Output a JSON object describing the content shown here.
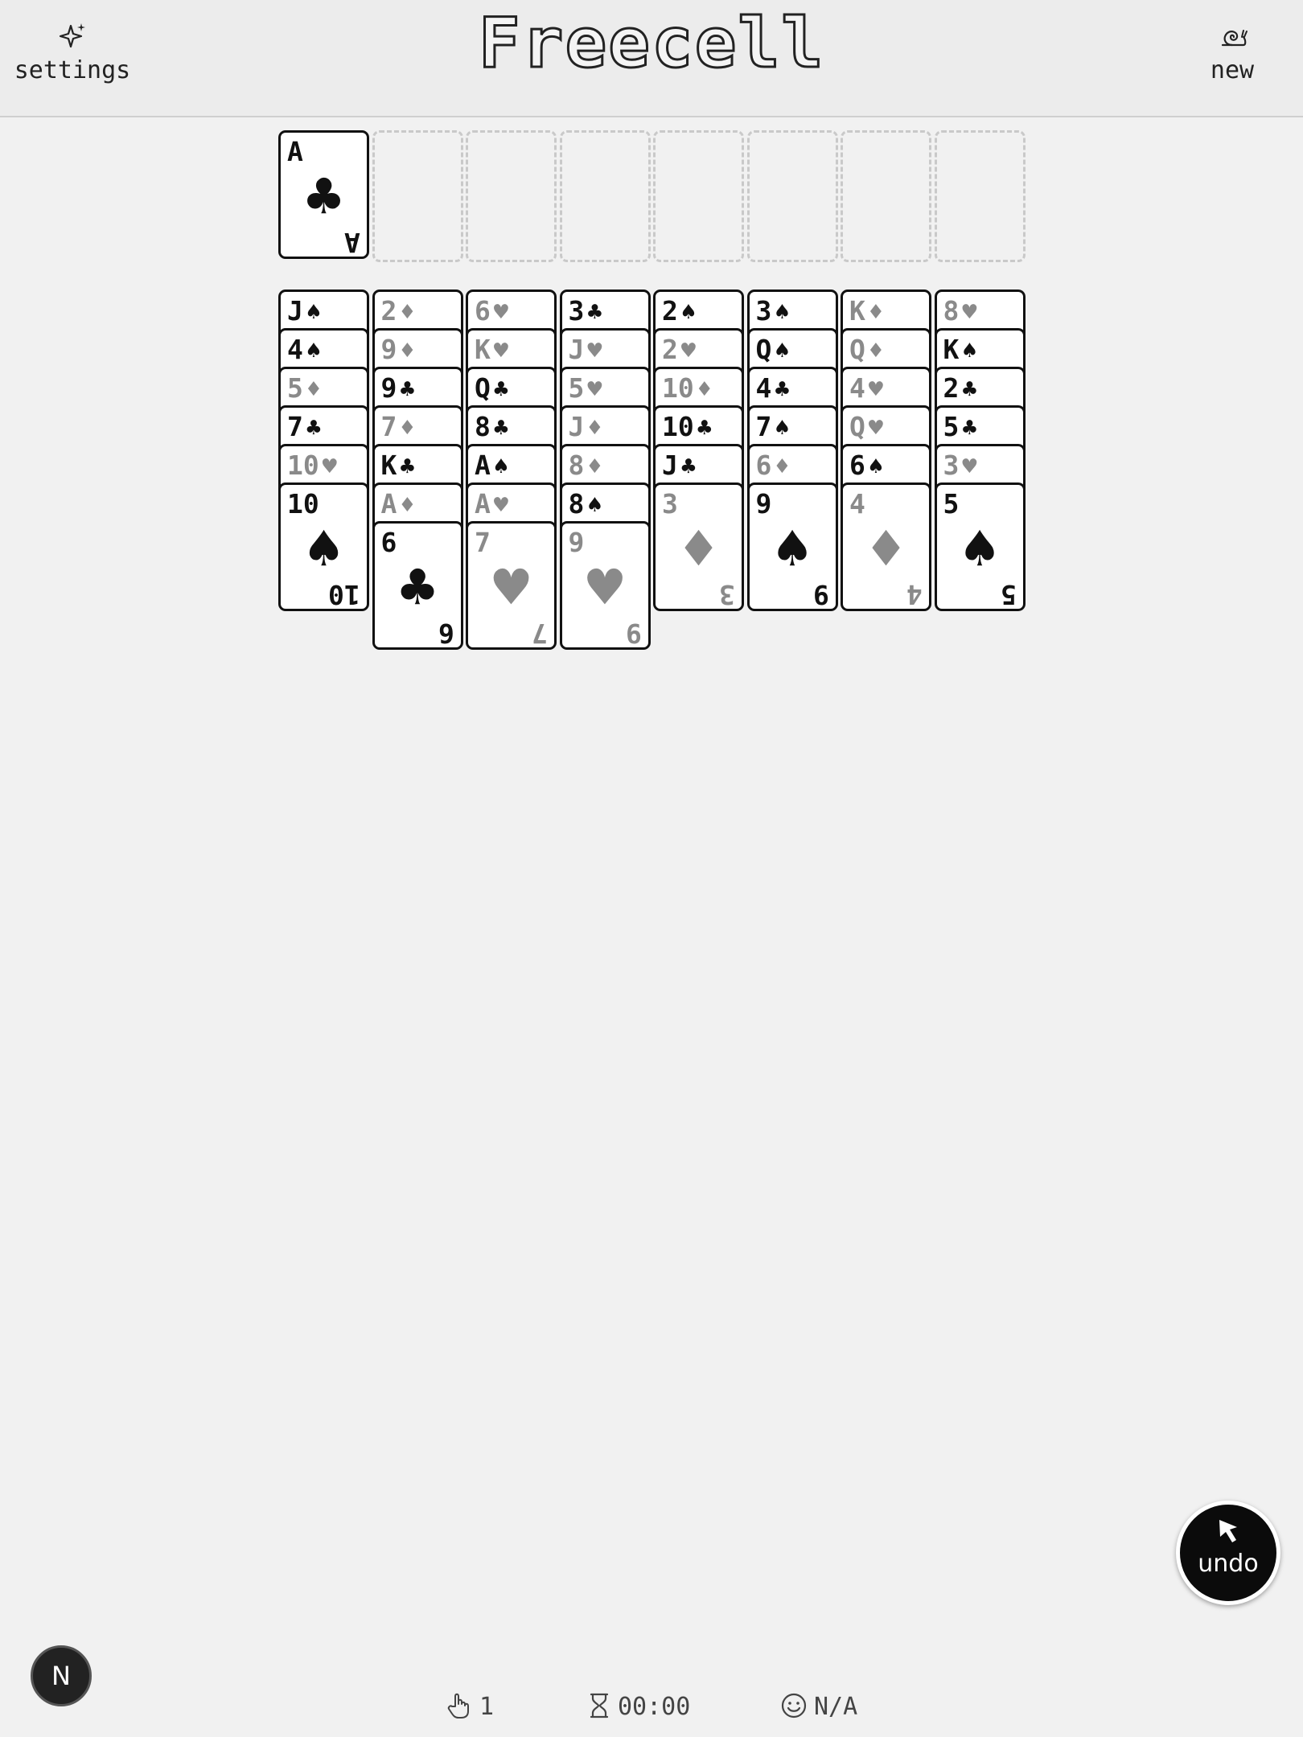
{
  "header": {
    "title": "Freecell",
    "settings_label": "settings",
    "new_label": "new",
    "settings_icon": "sparkle-icon",
    "new_icon": "snail-icon"
  },
  "colors": {
    "red_suit": "#8a8a8a",
    "black_suit": "#111111",
    "background": "#f1f1f1"
  },
  "foundation": {
    "cards": [
      {
        "rank": "A",
        "suit": "♣",
        "color": "black"
      }
    ],
    "empty_slots": 7
  },
  "tableau": {
    "columns": [
      [
        {
          "rank": "J",
          "suit": "♠",
          "color": "black"
        },
        {
          "rank": "4",
          "suit": "♠",
          "color": "black"
        },
        {
          "rank": "5",
          "suit": "♦",
          "color": "red"
        },
        {
          "rank": "7",
          "suit": "♣",
          "color": "black"
        },
        {
          "rank": "10",
          "suit": "♥",
          "color": "red"
        },
        {
          "rank": "10",
          "suit": "♠",
          "color": "black"
        }
      ],
      [
        {
          "rank": "2",
          "suit": "♦",
          "color": "red"
        },
        {
          "rank": "9",
          "suit": "♦",
          "color": "red"
        },
        {
          "rank": "9",
          "suit": "♣",
          "color": "black"
        },
        {
          "rank": "7",
          "suit": "♦",
          "color": "red"
        },
        {
          "rank": "K",
          "suit": "♣",
          "color": "black"
        },
        {
          "rank": "A",
          "suit": "♦",
          "color": "red"
        },
        {
          "rank": "6",
          "suit": "♣",
          "color": "black"
        }
      ],
      [
        {
          "rank": "6",
          "suit": "♥",
          "color": "red"
        },
        {
          "rank": "K",
          "suit": "♥",
          "color": "red"
        },
        {
          "rank": "Q",
          "suit": "♣",
          "color": "black"
        },
        {
          "rank": "8",
          "suit": "♣",
          "color": "black"
        },
        {
          "rank": "A",
          "suit": "♠",
          "color": "black"
        },
        {
          "rank": "A",
          "suit": "♥",
          "color": "red"
        },
        {
          "rank": "7",
          "suit": "♥",
          "color": "red"
        }
      ],
      [
        {
          "rank": "3",
          "suit": "♣",
          "color": "black"
        },
        {
          "rank": "J",
          "suit": "♥",
          "color": "red"
        },
        {
          "rank": "5",
          "suit": "♥",
          "color": "red"
        },
        {
          "rank": "J",
          "suit": "♦",
          "color": "red"
        },
        {
          "rank": "8",
          "suit": "♦",
          "color": "red"
        },
        {
          "rank": "8",
          "suit": "♠",
          "color": "black"
        },
        {
          "rank": "9",
          "suit": "♥",
          "color": "red"
        }
      ],
      [
        {
          "rank": "2",
          "suit": "♠",
          "color": "black"
        },
        {
          "rank": "2",
          "suit": "♥",
          "color": "red"
        },
        {
          "rank": "10",
          "suit": "♦",
          "color": "red"
        },
        {
          "rank": "10",
          "suit": "♣",
          "color": "black"
        },
        {
          "rank": "J",
          "suit": "♣",
          "color": "black"
        },
        {
          "rank": "3",
          "suit": "♦",
          "color": "red"
        }
      ],
      [
        {
          "rank": "3",
          "suit": "♠",
          "color": "black"
        },
        {
          "rank": "Q",
          "suit": "♠",
          "color": "black"
        },
        {
          "rank": "4",
          "suit": "♣",
          "color": "black"
        },
        {
          "rank": "7",
          "suit": "♠",
          "color": "black"
        },
        {
          "rank": "6",
          "suit": "♦",
          "color": "red"
        },
        {
          "rank": "9",
          "suit": "♠",
          "color": "black"
        }
      ],
      [
        {
          "rank": "K",
          "suit": "♦",
          "color": "red"
        },
        {
          "rank": "Q",
          "suit": "♦",
          "color": "red"
        },
        {
          "rank": "4",
          "suit": "♥",
          "color": "red"
        },
        {
          "rank": "Q",
          "suit": "♥",
          "color": "red"
        },
        {
          "rank": "6",
          "suit": "♠",
          "color": "black"
        },
        {
          "rank": "4",
          "suit": "♦",
          "color": "red"
        }
      ],
      [
        {
          "rank": "8",
          "suit": "♥",
          "color": "red"
        },
        {
          "rank": "K",
          "suit": "♠",
          "color": "black"
        },
        {
          "rank": "2",
          "suit": "♣",
          "color": "black"
        },
        {
          "rank": "5",
          "suit": "♣",
          "color": "black"
        },
        {
          "rank": "3",
          "suit": "♥",
          "color": "red"
        },
        {
          "rank": "5",
          "suit": "♠",
          "color": "black"
        }
      ]
    ]
  },
  "undo": {
    "label": "undo",
    "icon": "cursor-icon"
  },
  "badge": {
    "label": "N"
  },
  "status": {
    "moves": "1",
    "time": "00:00",
    "score": "N/A",
    "moves_icon": "hand-pointer-icon",
    "time_icon": "hourglass-icon",
    "score_icon": "smiley-icon"
  }
}
